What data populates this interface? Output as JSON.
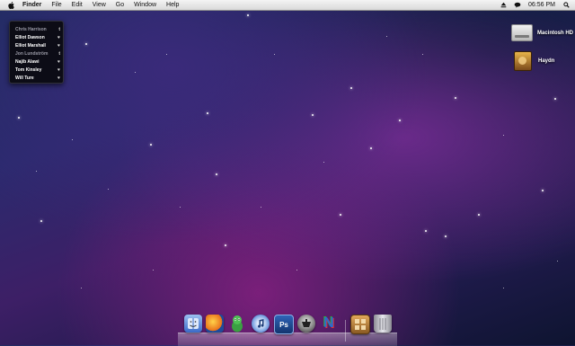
{
  "menubar": {
    "items": [
      "Finder",
      "File",
      "Edit",
      "View",
      "Go",
      "Window",
      "Help"
    ],
    "clock": "06:56 PM"
  },
  "widget": {
    "contacts": [
      {
        "name": "Chris Harrison",
        "icon": "t",
        "dim": true
      },
      {
        "name": "Elliot Dawson",
        "icon": "♥",
        "dim": false
      },
      {
        "name": "Elliot Marshall",
        "icon": "♥",
        "dim": false
      },
      {
        "name": "Jon Lundström",
        "icon": "t",
        "dim": true
      },
      {
        "name": "Najib Alawi",
        "icon": "♥",
        "dim": false
      },
      {
        "name": "Tom Kinsley",
        "icon": "♥",
        "dim": false
      },
      {
        "name": "Will Ture",
        "icon": "♥",
        "dim": false
      }
    ]
  },
  "desktop_icons": [
    {
      "label": "Macintosh HD",
      "type": "hard-drive"
    },
    {
      "label": "Haydn",
      "type": "folder"
    }
  ],
  "dock": {
    "apps": [
      {
        "name": "finder-app",
        "color": "#4a7ed8"
      },
      {
        "name": "firefox-app",
        "color": "#e8701a"
      },
      {
        "name": "adium-app",
        "color": "#3aa042"
      },
      {
        "name": "itunes-app",
        "color": "#5a8cd8"
      },
      {
        "name": "photoshop-app",
        "color": "#1e4a8a",
        "glyph": "Ps"
      },
      {
        "name": "transmission-app",
        "color": "#555555"
      },
      {
        "name": "game-app",
        "color": "#2a6ad0",
        "glyph": "N"
      },
      {
        "name": "downloads-stack",
        "color": "#c88a3a"
      },
      {
        "name": "trash-can",
        "color": "#b8b8c0"
      }
    ]
  }
}
